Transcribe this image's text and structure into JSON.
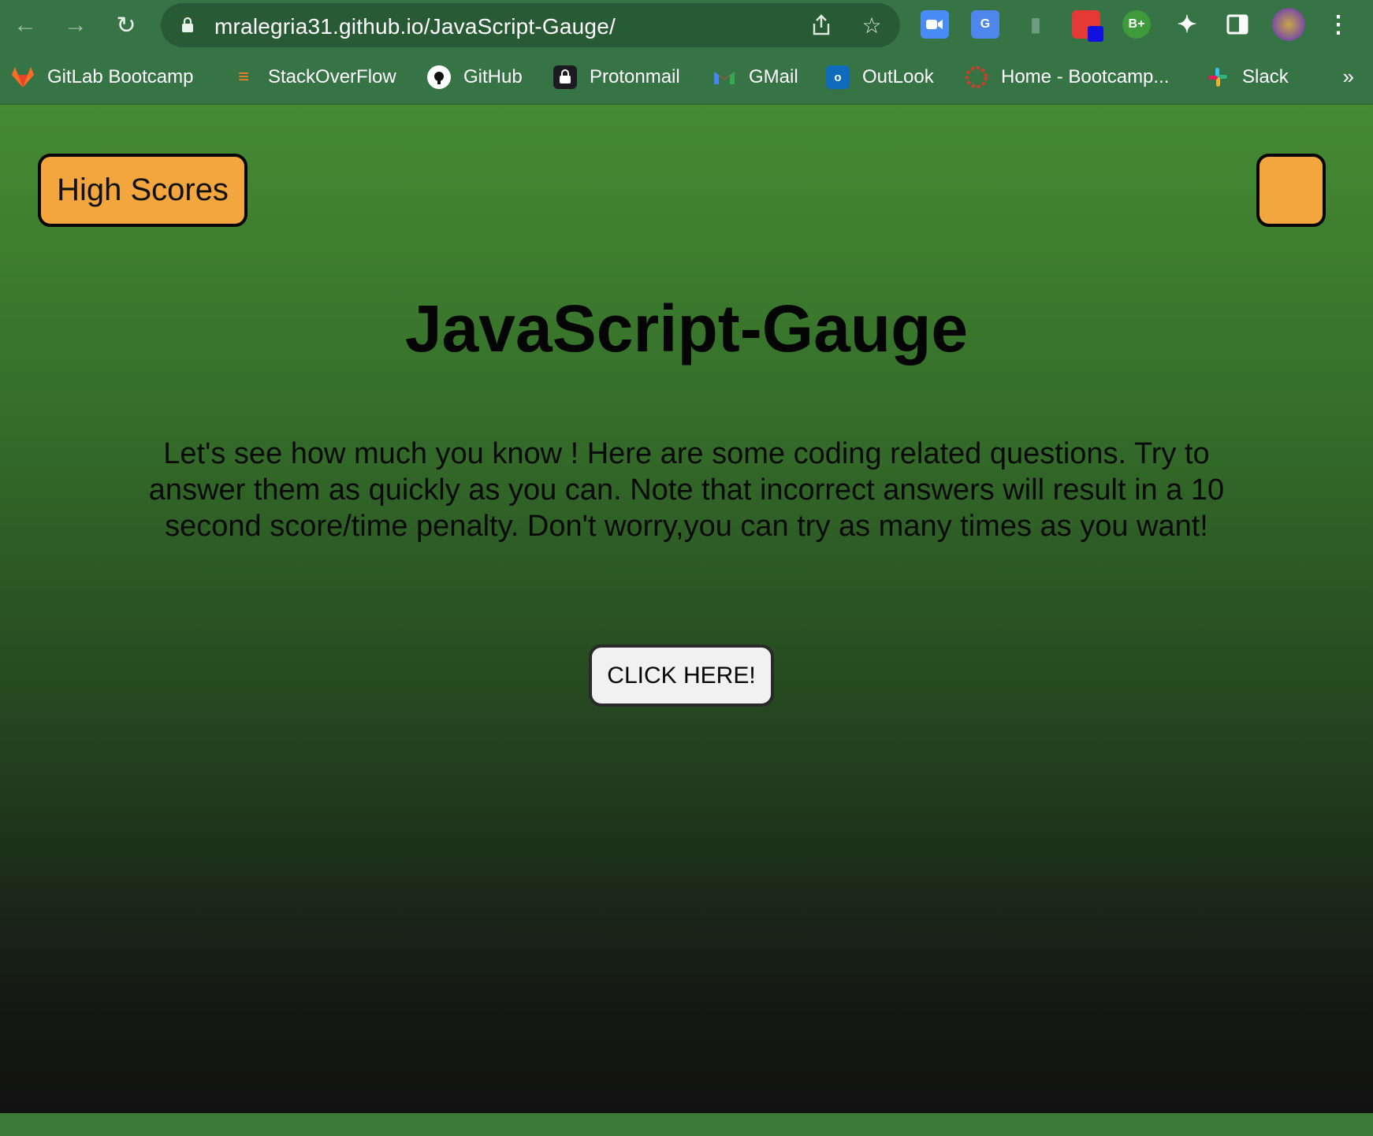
{
  "browser": {
    "url": "mralegria31.github.io/JavaScript-Gauge/",
    "bookmarks": [
      {
        "label": "GitLab Bootcamp",
        "icon": "gitlab-icon"
      },
      {
        "label": "StackOverFlow",
        "icon": "stackoverflow-icon"
      },
      {
        "label": "GitHub",
        "icon": "github-icon"
      },
      {
        "label": "Protonmail",
        "icon": "protonmail-icon"
      },
      {
        "label": "GMail",
        "icon": "gmail-icon"
      },
      {
        "label": "OutLook",
        "icon": "outlook-icon"
      },
      {
        "label": "Home - Bootcamp...",
        "icon": "bootcamp-icon"
      },
      {
        "label": "Slack",
        "icon": "slack-icon"
      }
    ],
    "more_bookmarks": "»",
    "extension_badge": "B+"
  },
  "page": {
    "high_scores_label": "High Scores",
    "title": "JavaScript-Gauge",
    "intro": "Let's see how much you know ! Here are some coding related questions. Try to answer them as quickly as you can. Note that incorrect answers will result in a 10 second score/time penalty. Don't worry,you can try as many times as you want!",
    "start_label": "CLICK HERE!"
  },
  "colors": {
    "accent_button": "#f2a63d",
    "chrome": "#367345",
    "gradient_top": "#458b33",
    "gradient_bottom": "#121212"
  }
}
